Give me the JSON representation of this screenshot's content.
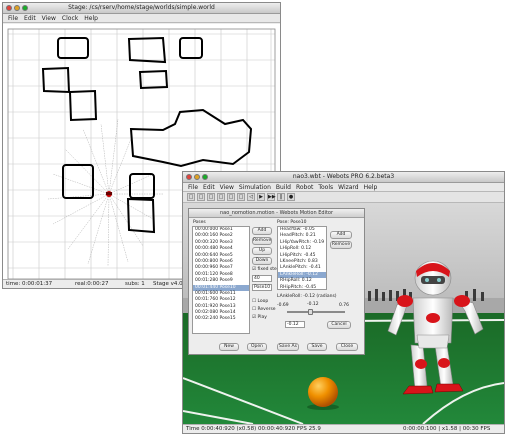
{
  "stage": {
    "title": "Stage: /cs/rserv/home/stage/worlds/simple.world",
    "menu": [
      "File",
      "Edit",
      "View",
      "Clock",
      "Help"
    ],
    "status": {
      "time": "time: 0:00:01:37",
      "real": "real:0:00:27",
      "subs": "subs: 1",
      "mode": "Stage v4.0.0"
    }
  },
  "webots": {
    "title": "nao3.wbt - Webots PRO 6.2.beta3",
    "menu": [
      "File",
      "Edit",
      "View",
      "Simulation",
      "Build",
      "Robot",
      "Tools",
      "Wizard",
      "Help"
    ],
    "toolbar": [
      "□",
      "□",
      "□",
      "□",
      "□",
      "□",
      "◁",
      "▶",
      "▶▶",
      "‖",
      "●"
    ],
    "status": "Time 0:00:40:920 (x0.58)   00:00:40:920   FPS 25.9",
    "status_right": "0:00:00:100 | x1.58 | 00:30 FPS"
  },
  "motion": {
    "title": "nao_nomotion.motion - Webots Motion Editor",
    "poses_label": "Poses",
    "poses": [
      "00:00:000 Pose1",
      "00:00:160 Pose2",
      "00:00:320 Pose3",
      "00:00:480 Pose4",
      "00:00:640 Pose5",
      "00:00:800 Pose6",
      "00:00:960 Pose7",
      "00:01:120 Pose8",
      "00:01:280 Pose9",
      "00:01:440 Pose10",
      "00:01:600 Pose11",
      "00:01:760 Pose12",
      "00:01:920 Pose13",
      "00:02:080 Pose14",
      "00:02:240 Pose15"
    ],
    "selected_pose_index": 9,
    "pose_buttons": [
      "Add",
      "Remove",
      "Up",
      "Down"
    ],
    "fixed_step_label": "fixed step",
    "step_value": "40",
    "name_value": "Pose10",
    "loop_label": "Loop",
    "reverse_label": "Reverse",
    "play_label": "Play",
    "pose_name_header": "Pose: Pose10",
    "joints": [
      "HeadYaw: -0.05",
      "HeadPitch: 0.21",
      "LHipYawPitch: -0.19",
      "LHipRoll: 0.12",
      "LHipPitch: -0.45",
      "LKneePitch: 0.83",
      "LAnklePitch: -0.41",
      "LAnkleRoll: -0.12",
      "RHipRoll: 0.12",
      "RHipPitch: -0.45"
    ],
    "selected_joint_index": 7,
    "joint_buttons": [
      "Add",
      "Remove"
    ],
    "value_header": "LAnkleRoll: -0.12 (radians)",
    "min_label": "-0.69",
    "max_label": "0.76",
    "current_value": "-0.12",
    "spin_value": "-0.12",
    "cancel_label": "Cancel",
    "footer_buttons": [
      "New",
      "Open",
      "Save As",
      "Save",
      "Close"
    ]
  },
  "colors": {
    "field": "#1d7a2c",
    "wall": "#d8d8d8",
    "ball": "#ee8a00",
    "robot_red": "#d8141a",
    "robot_white": "#f1f1f1",
    "laser_dot": "#cc0000"
  }
}
